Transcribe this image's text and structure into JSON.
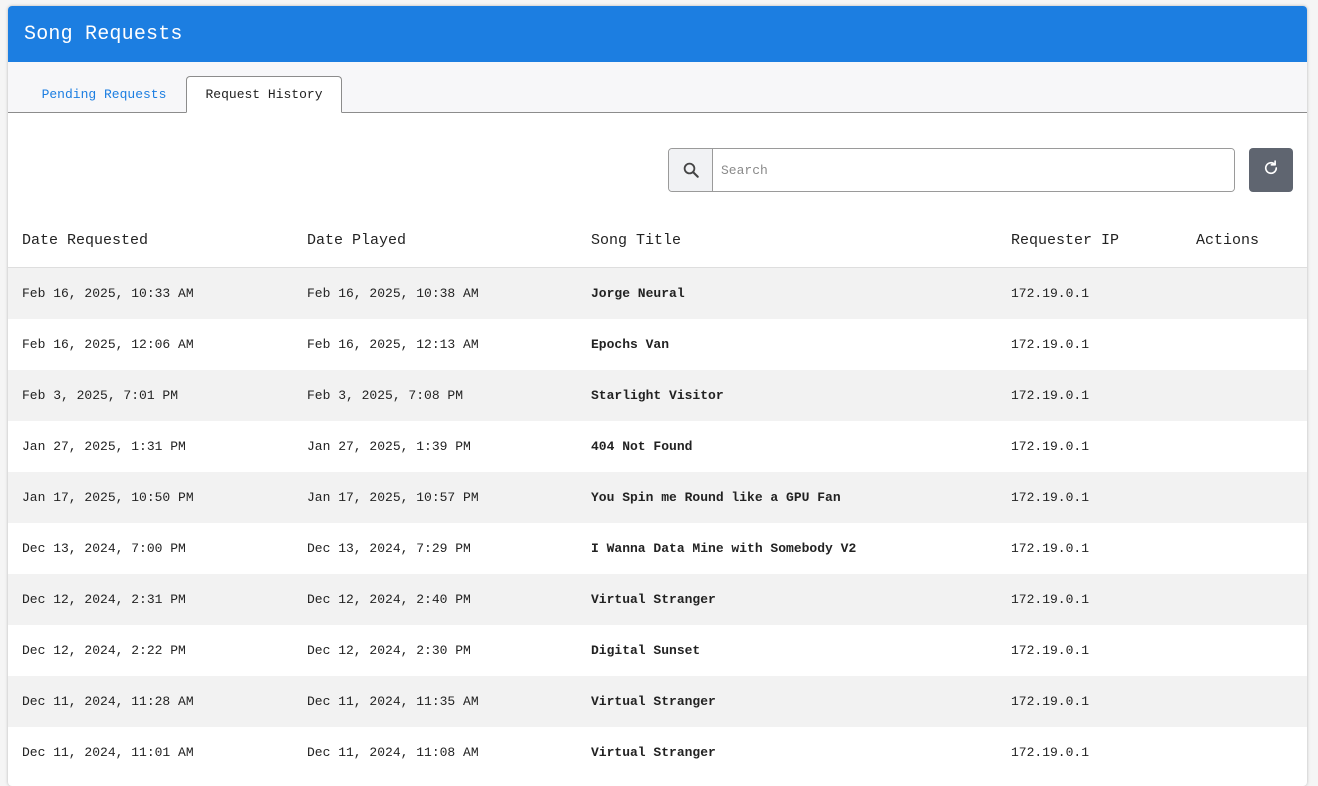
{
  "header": {
    "title": "Song Requests"
  },
  "tabs": [
    {
      "label": "Pending Requests",
      "active": false
    },
    {
      "label": "Request History",
      "active": true
    }
  ],
  "search": {
    "placeholder": "Search",
    "value": ""
  },
  "icons": {
    "search": "search-icon",
    "refresh": "refresh-icon"
  },
  "colors": {
    "accent": "#1c7ee1",
    "refresh_button": "#5f6570",
    "row_stripe": "#f2f2f2"
  },
  "table": {
    "columns": [
      "Date Requested",
      "Date Played",
      "Song Title",
      "Requester IP",
      "Actions"
    ],
    "rows": [
      {
        "requested": "Feb 16, 2025, 10:33 AM",
        "played": "Feb 16, 2025, 10:38 AM",
        "title": "Jorge Neural",
        "ip": "172.19.0.1"
      },
      {
        "requested": "Feb 16, 2025, 12:06 AM",
        "played": "Feb 16, 2025, 12:13 AM",
        "title": "Epochs Van",
        "ip": "172.19.0.1"
      },
      {
        "requested": "Feb 3, 2025, 7:01 PM",
        "played": "Feb 3, 2025, 7:08 PM",
        "title": "Starlight Visitor",
        "ip": "172.19.0.1"
      },
      {
        "requested": "Jan 27, 2025, 1:31 PM",
        "played": "Jan 27, 2025, 1:39 PM",
        "title": "404 Not Found",
        "ip": "172.19.0.1"
      },
      {
        "requested": "Jan 17, 2025, 10:50 PM",
        "played": "Jan 17, 2025, 10:57 PM",
        "title": "You Spin me Round like a GPU Fan",
        "ip": "172.19.0.1"
      },
      {
        "requested": "Dec 13, 2024, 7:00 PM",
        "played": "Dec 13, 2024, 7:29 PM",
        "title": "I Wanna Data Mine with Somebody V2",
        "ip": "172.19.0.1"
      },
      {
        "requested": "Dec 12, 2024, 2:31 PM",
        "played": "Dec 12, 2024, 2:40 PM",
        "title": "Virtual Stranger",
        "ip": "172.19.0.1"
      },
      {
        "requested": "Dec 12, 2024, 2:22 PM",
        "played": "Dec 12, 2024, 2:30 PM",
        "title": "Digital Sunset",
        "ip": "172.19.0.1"
      },
      {
        "requested": "Dec 11, 2024, 11:28 AM",
        "played": "Dec 11, 2024, 11:35 AM",
        "title": "Virtual Stranger",
        "ip": "172.19.0.1"
      },
      {
        "requested": "Dec 11, 2024, 11:01 AM",
        "played": "Dec 11, 2024, 11:08 AM",
        "title": "Virtual Stranger",
        "ip": "172.19.0.1"
      }
    ]
  }
}
